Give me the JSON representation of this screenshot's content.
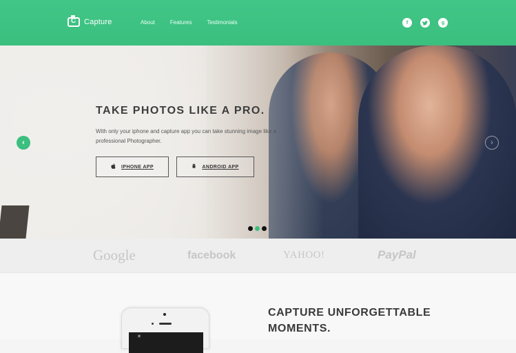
{
  "header": {
    "logo_text": "Capture",
    "nav": [
      "About",
      "Features",
      "Testimonials"
    ],
    "social": [
      {
        "icon": "facebook-icon",
        "glyph": "f"
      },
      {
        "icon": "twitter-icon",
        "glyph": "t"
      },
      {
        "icon": "google-plus-icon",
        "glyph": "g"
      }
    ],
    "accent_color": "#3bbf7f"
  },
  "hero": {
    "headline": "TAKE PHOTOS LIKE A PRO.",
    "tagline": "With only your iphone and capture app you can take stunning image like a professional Photographer.",
    "buttons": {
      "iphone": "IPHONE APP",
      "android": "ANDROID APP"
    },
    "slide_count": 3,
    "active_slide": 2
  },
  "partners": [
    "Google",
    "facebook",
    "YAHOO!",
    "PayPal"
  ],
  "feature": {
    "title": "CAPTURE UNFORGETTABLE MOMENTS."
  }
}
